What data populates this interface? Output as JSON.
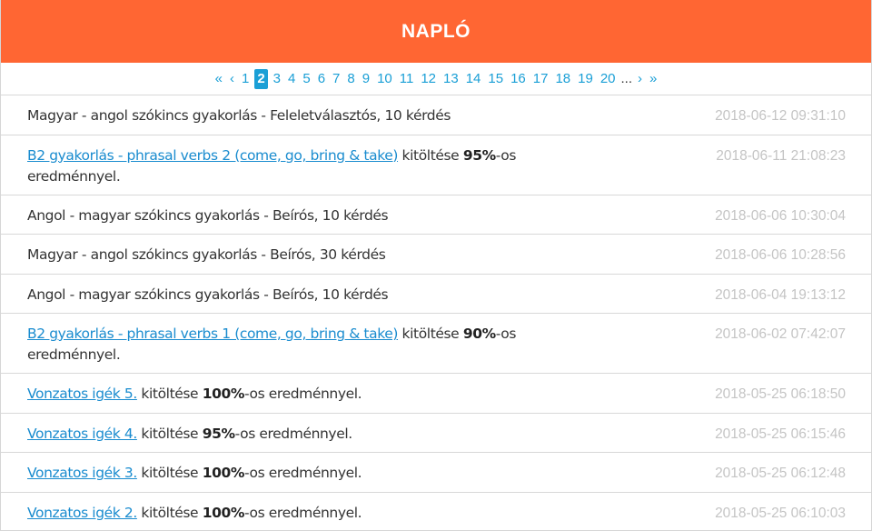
{
  "header": {
    "title": "NAPLÓ"
  },
  "pagination": {
    "first": "«",
    "prev": "‹",
    "pages": [
      "1",
      "2",
      "3",
      "4",
      "5",
      "6",
      "7",
      "8",
      "9",
      "10",
      "11",
      "12",
      "13",
      "14",
      "15",
      "16",
      "17",
      "18",
      "19",
      "20"
    ],
    "current": "2",
    "ellipsis": "...",
    "next": "›",
    "last": "»"
  },
  "entries": [
    {
      "link": "",
      "text": "Magyar - angol szókincs gyakorlás - Feleletválasztós, 10 kérdés",
      "score": "",
      "suffix": "",
      "date": "2018-06-12 09:31:10"
    },
    {
      "link": "B2 gyakorlás - phrasal verbs 2 (come, go, bring & take)",
      "text": " kitöltése ",
      "score": "95%",
      "suffix": "-os eredménnyel.",
      "date": "2018-06-11 21:08:23"
    },
    {
      "link": "",
      "text": "Angol - magyar szókincs gyakorlás - Beírós, 10 kérdés",
      "score": "",
      "suffix": "",
      "date": "2018-06-06 10:30:04"
    },
    {
      "link": "",
      "text": "Magyar - angol szókincs gyakorlás - Beírós, 30 kérdés",
      "score": "",
      "suffix": "",
      "date": "2018-06-06 10:28:56"
    },
    {
      "link": "",
      "text": "Angol - magyar szókincs gyakorlás - Beírós, 10 kérdés",
      "score": "",
      "suffix": "",
      "date": "2018-06-04 19:13:12"
    },
    {
      "link": "B2 gyakorlás - phrasal verbs 1 (come, go, bring & take)",
      "text": " kitöltése ",
      "score": "90%",
      "suffix": "-os eredménnyel.",
      "date": "2018-06-02 07:42:07"
    },
    {
      "link": "Vonzatos igék 5.",
      "text": " kitöltése ",
      "score": "100%",
      "suffix": "-os eredménnyel.",
      "date": "2018-05-25 06:18:50"
    },
    {
      "link": "Vonzatos igék 4.",
      "text": " kitöltése ",
      "score": "95%",
      "suffix": "-os eredménnyel.",
      "date": "2018-05-25 06:15:46"
    },
    {
      "link": "Vonzatos igék 3.",
      "text": " kitöltése ",
      "score": "100%",
      "suffix": "-os eredménnyel.",
      "date": "2018-05-25 06:12:48"
    },
    {
      "link": "Vonzatos igék 2.",
      "text": " kitöltése ",
      "score": "100%",
      "suffix": "-os eredménnyel.",
      "date": "2018-05-25 06:10:03"
    }
  ]
}
